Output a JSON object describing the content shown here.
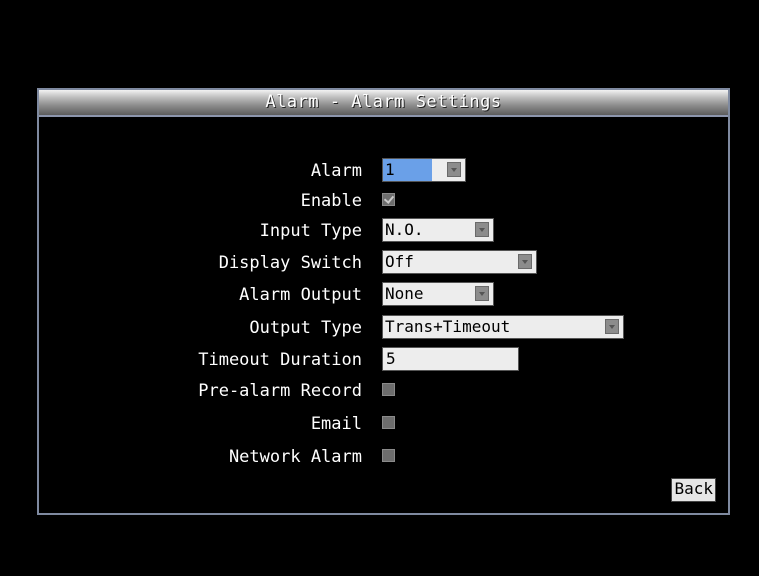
{
  "window": {
    "title": "Alarm - Alarm Settings"
  },
  "form": {
    "alarm": {
      "label": "Alarm",
      "value": "1"
    },
    "enable": {
      "label": "Enable",
      "checked": true
    },
    "input_type": {
      "label": "Input Type",
      "value": "N.O."
    },
    "display_switch": {
      "label": "Display Switch",
      "value": "Off"
    },
    "alarm_output": {
      "label": "Alarm Output",
      "value": "None"
    },
    "output_type": {
      "label": "Output Type",
      "value": "Trans+Timeout"
    },
    "timeout_duration": {
      "label": "Timeout Duration",
      "value": "5"
    },
    "pre_alarm_record": {
      "label": "Pre-alarm Record",
      "checked": false
    },
    "email": {
      "label": "Email",
      "checked": false
    },
    "network_alarm": {
      "label": "Network Alarm",
      "checked": false
    }
  },
  "footer": {
    "back_label": "Back"
  },
  "colors": {
    "background": "#000000",
    "panel_border": "#7f8aa0",
    "field_bg": "#ededed",
    "highlight": "#6aa0e8"
  }
}
